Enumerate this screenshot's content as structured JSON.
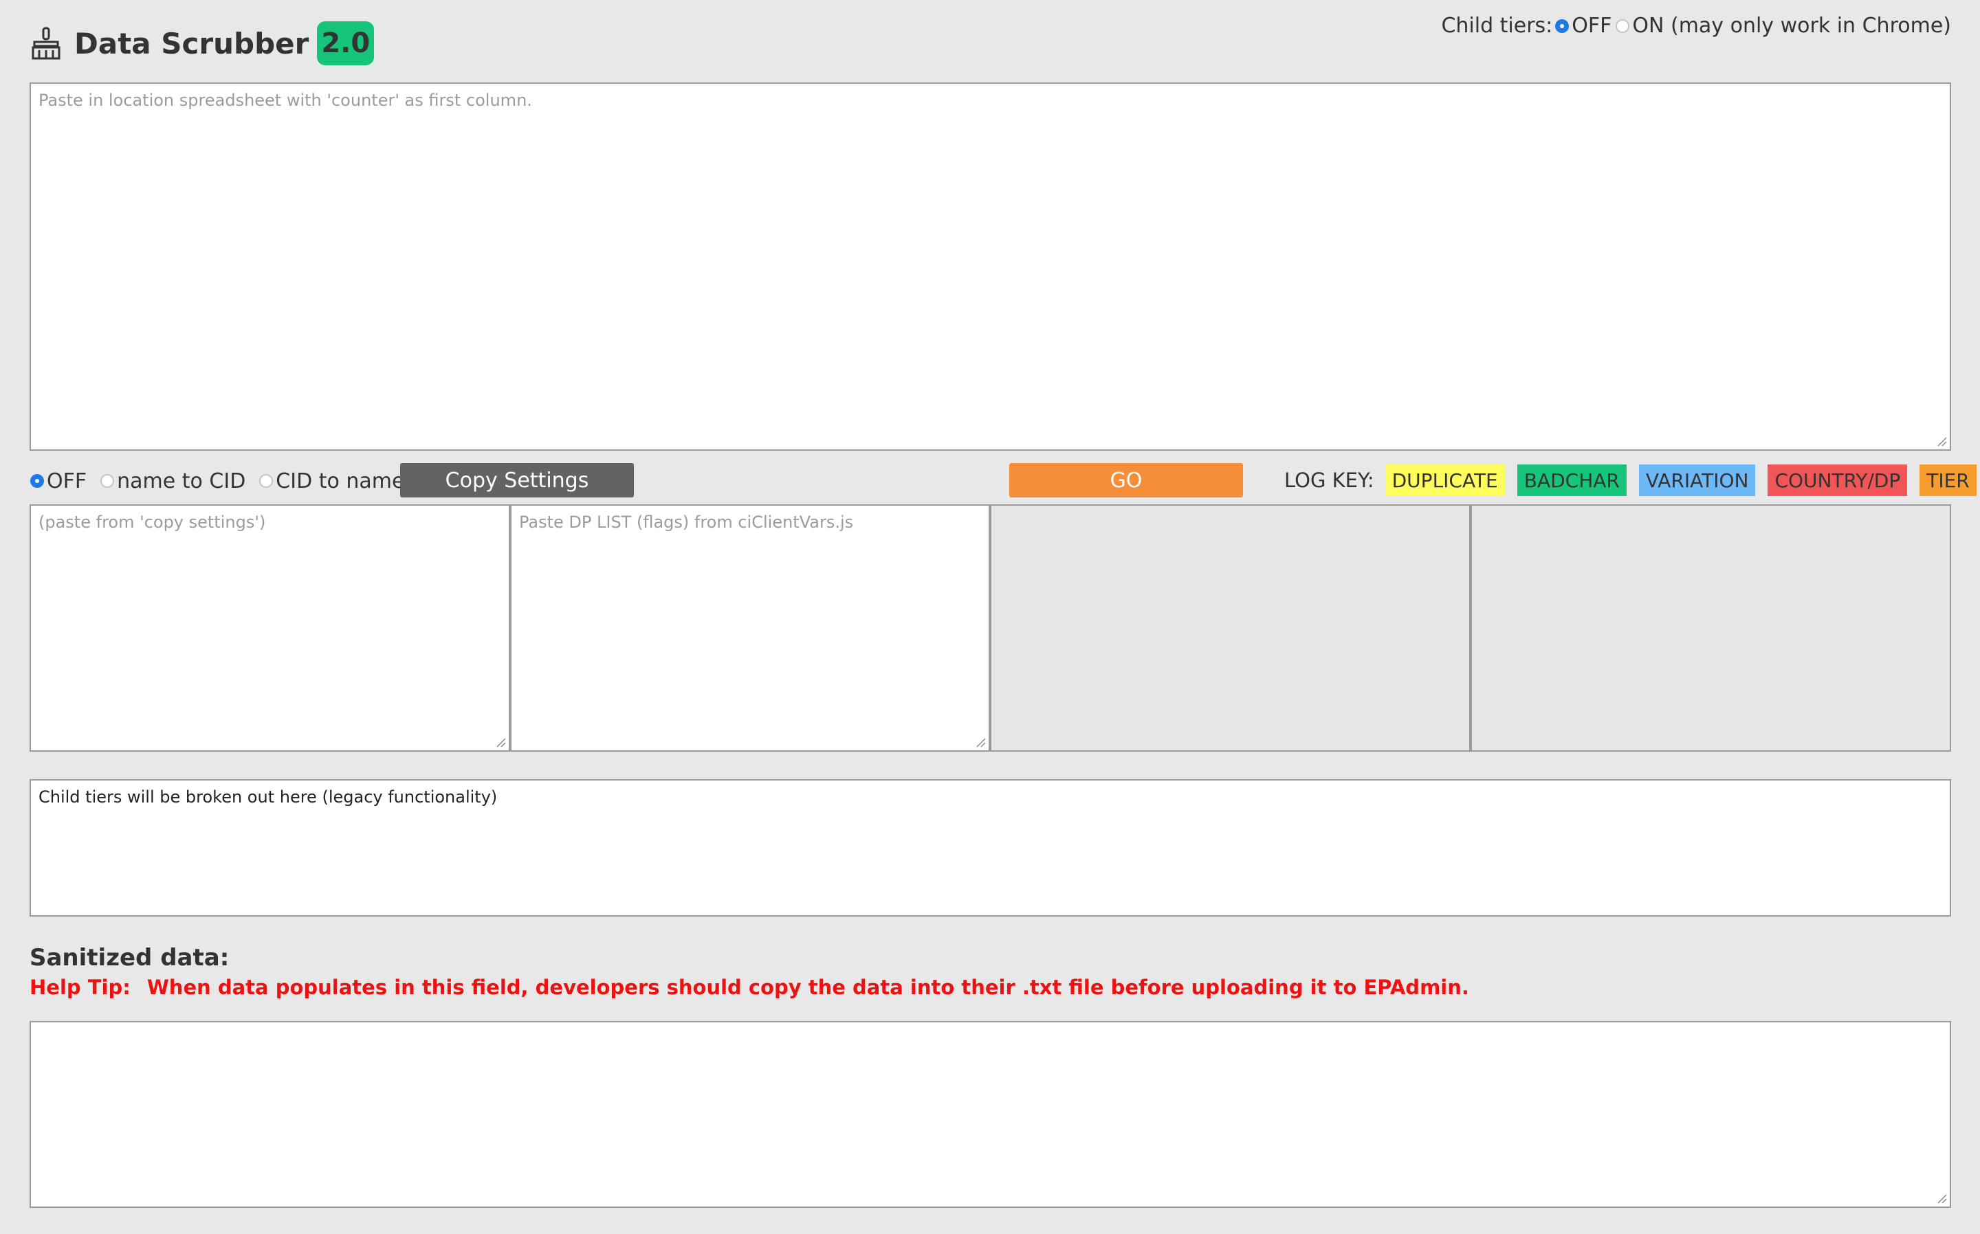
{
  "header": {
    "title": "Data Scrubber",
    "version": "2.0",
    "icon": "broom-icon",
    "brand_color": "#16c47a"
  },
  "child_tiers": {
    "label": "Child tiers:",
    "options": [
      {
        "label": "OFF",
        "checked": true
      },
      {
        "label": "ON (may only work in Chrome)",
        "checked": false
      }
    ]
  },
  "input": {
    "placeholder": "Paste in location spreadsheet with 'counter' as first column."
  },
  "mode": {
    "options": [
      {
        "label": "OFF",
        "checked": true
      },
      {
        "label": "name to CID",
        "checked": false
      },
      {
        "label": "CID to name",
        "checked": false
      }
    ]
  },
  "buttons": {
    "copy_settings": "Copy Settings",
    "go": "GO",
    "go_color": "#f58d39",
    "copy_settings_color": "#636363"
  },
  "log_key": {
    "label": "LOG KEY:",
    "tags": [
      {
        "label": "DUPLICATE",
        "color": "#fdfd5e"
      },
      {
        "label": "BADCHAR",
        "color": "#16c47a"
      },
      {
        "label": "VARIATION",
        "color": "#6db8f7"
      },
      {
        "label": "COUNTRY/DP",
        "color": "#f25555"
      },
      {
        "label": "TIER",
        "color": "#f79d2e"
      }
    ]
  },
  "panels": {
    "settings_placeholder": "(paste from 'copy settings')",
    "dp_list_placeholder": "Paste DP LIST (flags) from ciClientVars.js"
  },
  "child_tier_output": {
    "text": "Child tiers will be broken out here (legacy functionality)"
  },
  "sanitized": {
    "title": "Sanitized data:",
    "help_label": "Help Tip:",
    "help_text": "When data populates in this field, developers should copy the data into their .txt file before uploading it to EPAdmin.",
    "help_color": "#ee1111"
  }
}
